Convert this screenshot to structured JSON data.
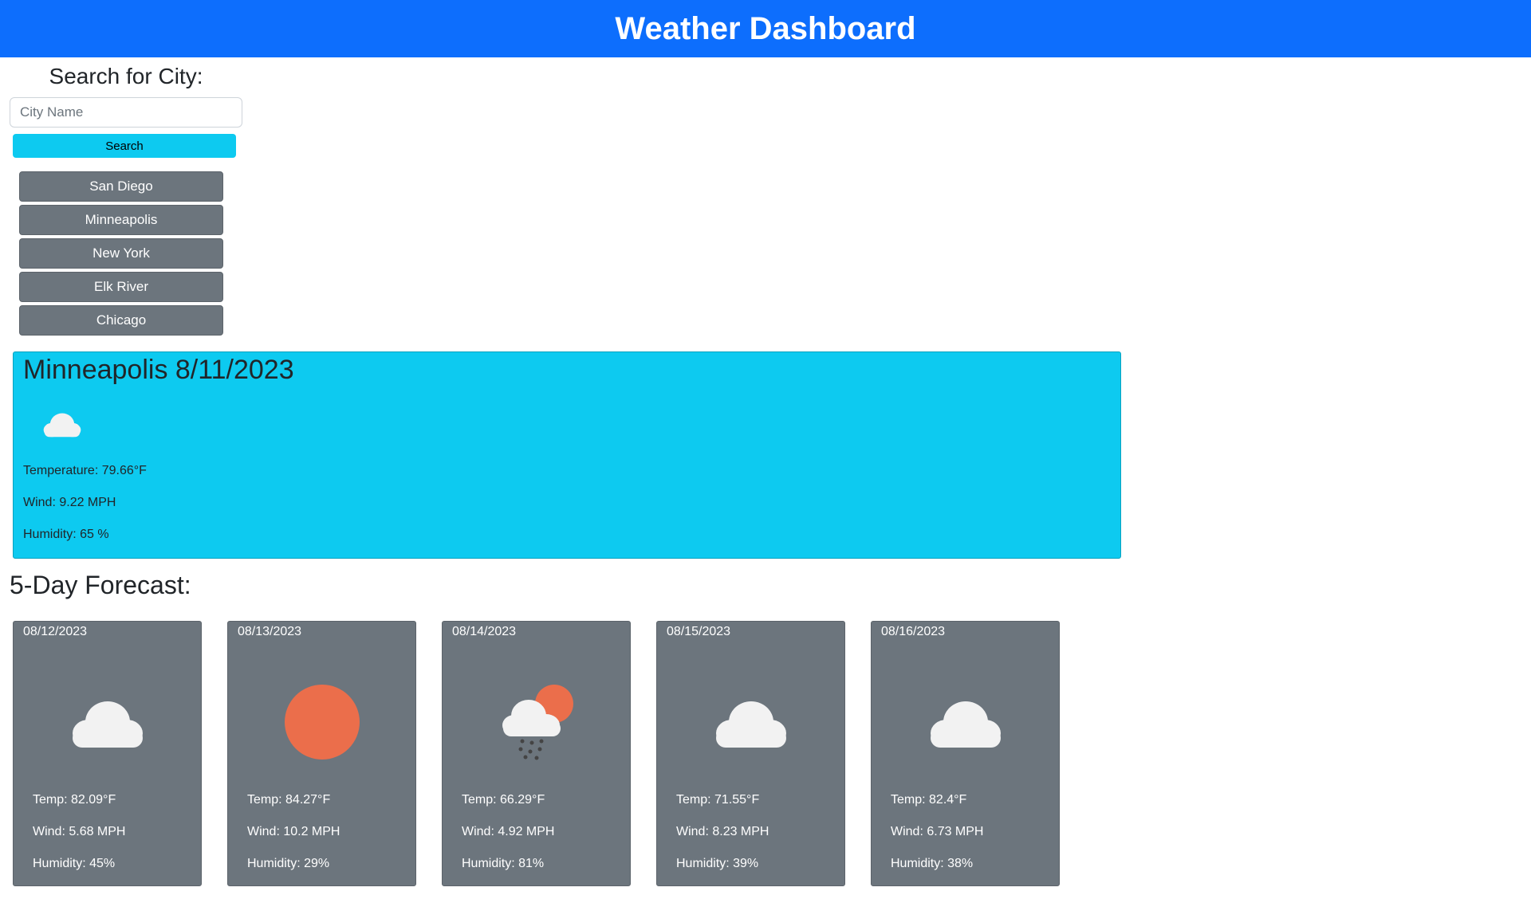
{
  "header": {
    "title": "Weather Dashboard"
  },
  "search": {
    "heading": "Search for City:",
    "placeholder": "City Name",
    "value": "",
    "button_label": "Search"
  },
  "history": [
    "San Diego",
    "Minneapolis",
    "New York",
    "Elk River",
    "Chicago"
  ],
  "current": {
    "title": "Minneapolis 8/11/2023",
    "icon": "cloud-icon",
    "temperature": "Temperature: 79.66°F",
    "wind": "Wind: 9.22 MPH",
    "humidity": "Humidity: 65 %"
  },
  "forecast": {
    "heading": "5-Day Forecast:",
    "days": [
      {
        "date": "08/12/2023",
        "icon": "cloud-icon",
        "temp": "Temp: 82.09°F",
        "wind": "Wind: 5.68 MPH",
        "humidity": "Humidity: 45%"
      },
      {
        "date": "08/13/2023",
        "icon": "sun-icon",
        "temp": "Temp: 84.27°F",
        "wind": "Wind: 10.2 MPH",
        "humidity": "Humidity: 29%"
      },
      {
        "date": "08/14/2023",
        "icon": "rain-sun-cloud-icon",
        "temp": "Temp: 66.29°F",
        "wind": "Wind: 4.92 MPH",
        "humidity": "Humidity: 81%"
      },
      {
        "date": "08/15/2023",
        "icon": "cloud-icon",
        "temp": "Temp: 71.55°F",
        "wind": "Wind: 8.23 MPH",
        "humidity": "Humidity: 39%"
      },
      {
        "date": "08/16/2023",
        "icon": "cloud-icon",
        "temp": "Temp: 82.4°F",
        "wind": "Wind: 6.73 MPH",
        "humidity": "Humidity: 38%"
      }
    ]
  },
  "colors": {
    "header_bg": "#0d6efd",
    "info": "#0dcaf0",
    "secondary": "#6c757d",
    "sun": "#eb6e4b",
    "cloud": "#f2f2f2"
  }
}
